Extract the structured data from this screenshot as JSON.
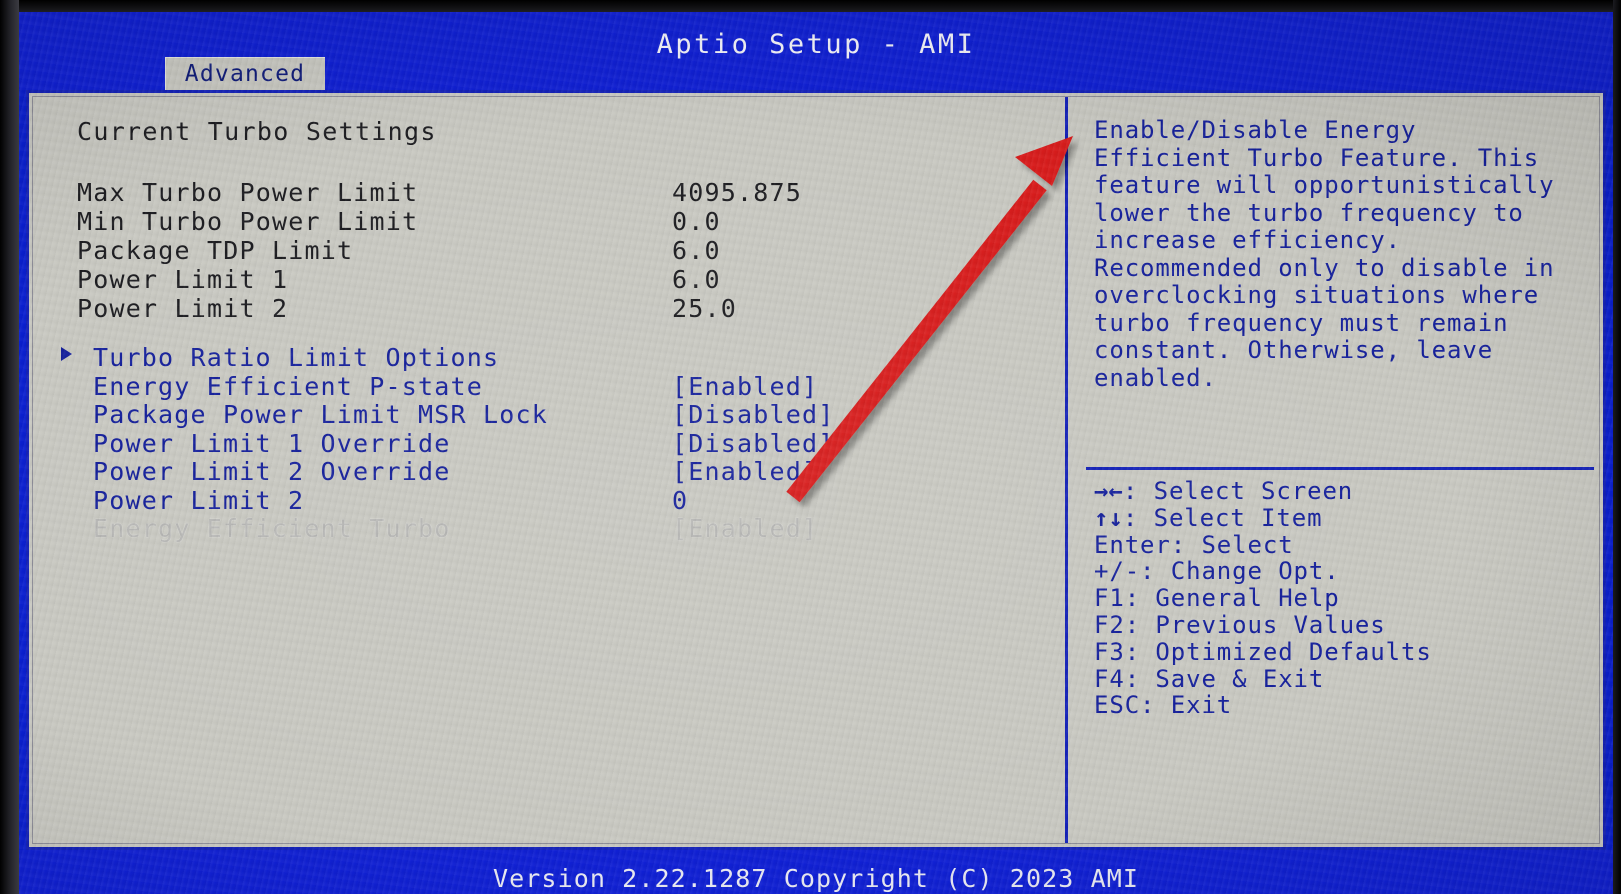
{
  "window": {
    "title": "Aptio Setup - AMI",
    "active_tab": "Advanced",
    "footer": "Version 2.22.1287 Copyright (C) 2023 AMI"
  },
  "main": {
    "section_heading": "Current Turbo Settings",
    "info_rows": [
      {
        "label": "Max Turbo Power Limit",
        "value": "4095.875"
      },
      {
        "label": "Min Turbo Power Limit",
        "value": "0.0"
      },
      {
        "label": "Package TDP Limit",
        "value": "6.0"
      },
      {
        "label": "Power Limit 1",
        "value": "6.0"
      },
      {
        "label": "Power Limit 2",
        "value": "25.0"
      }
    ],
    "option_rows": [
      {
        "label": "Turbo Ratio Limit Options",
        "value": "",
        "submenu": true,
        "selected": false
      },
      {
        "label": "Energy Efficient P-state",
        "value": "[Enabled]",
        "submenu": false,
        "selected": false
      },
      {
        "label": "Package Power Limit MSR Lock",
        "value": "[Disabled]",
        "submenu": false,
        "selected": false
      },
      {
        "label": "Power Limit 1 Override",
        "value": "[Disabled]",
        "submenu": false,
        "selected": false
      },
      {
        "label": "Power Limit 2 Override",
        "value": "[Enabled]",
        "submenu": false,
        "selected": false
      },
      {
        "label": "Power Limit 2",
        "value": "0",
        "submenu": false,
        "selected": false
      },
      {
        "label": "Energy Efficient Turbo",
        "value": "[Enabled]",
        "submenu": false,
        "selected": true
      }
    ]
  },
  "help": {
    "description": "Enable/Disable Energy\nEfficient Turbo Feature. This\nfeature will opportunistically\nlower the turbo frequency to\nincrease efficiency.\nRecommended only to disable in\noverclocking situations where\nturbo frequency must remain\nconstant. Otherwise, leave\nenabled.",
    "keys": [
      {
        "glyph": "→←",
        "text": ": Select Screen"
      },
      {
        "glyph": "↑↓",
        "text": ": Select Item"
      },
      {
        "glyph": "",
        "text": "Enter: Select"
      },
      {
        "glyph": "",
        "text": "+/-: Change Opt."
      },
      {
        "glyph": "",
        "text": "F1: General Help"
      },
      {
        "glyph": "",
        "text": "F2: Previous Values"
      },
      {
        "glyph": "",
        "text": "F3: Optimized Defaults"
      },
      {
        "glyph": "",
        "text": "F4: Save & Exit"
      },
      {
        "glyph": "",
        "text": "ESC: Exit"
      }
    ]
  },
  "annotation": {
    "arrow_color": "#d81f1f",
    "points_to": "Energy Efficient Turbo [Enabled]"
  },
  "colors": {
    "header_blue": "#1020d4",
    "panel_gray": "#c9c9c2",
    "text_blue": "#15209c",
    "text_dark": "#1c1c20",
    "border_blue": "#1422b9",
    "selected_gray": "#b8b8b6"
  }
}
